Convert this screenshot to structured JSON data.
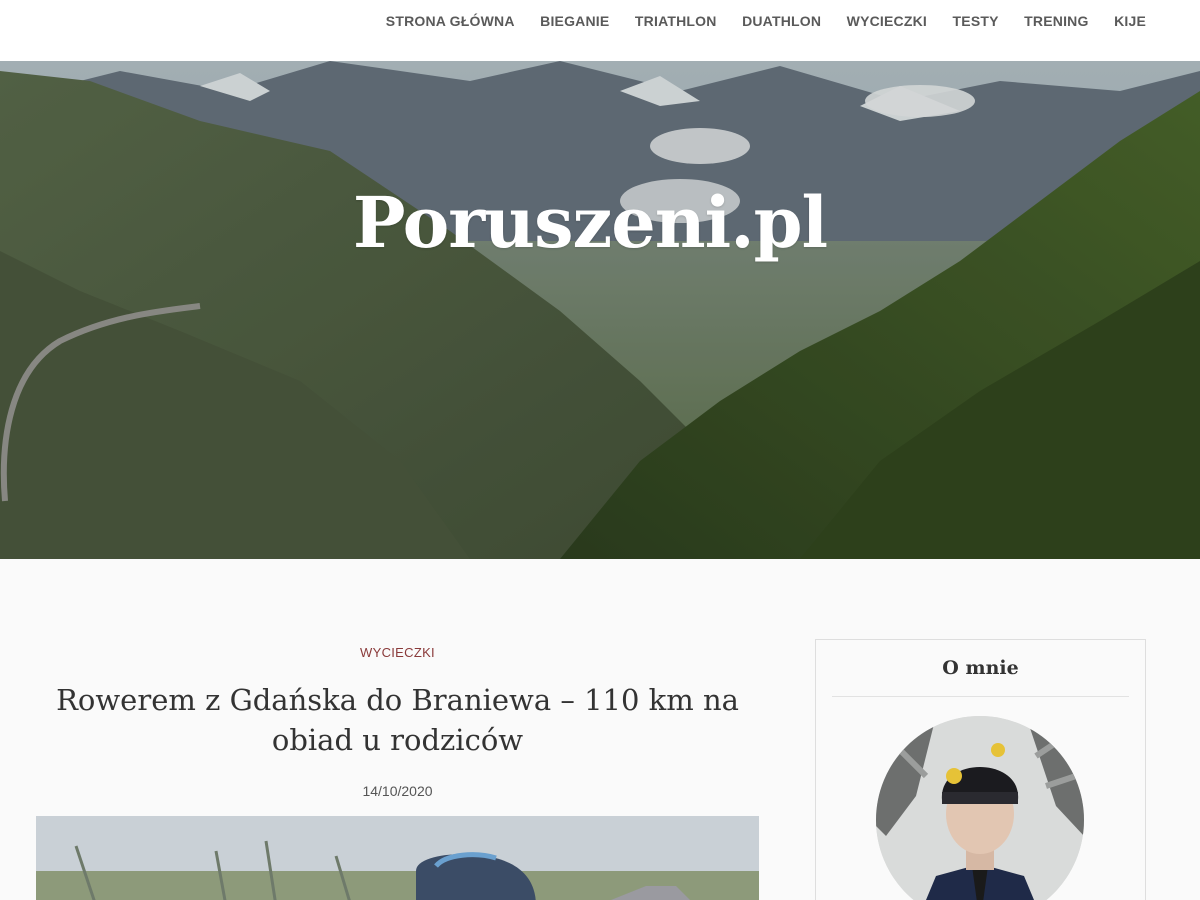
{
  "nav": {
    "items": [
      {
        "label": "STRONA GŁÓWNA"
      },
      {
        "label": "BIEGANIE"
      },
      {
        "label": "TRIATHLON"
      },
      {
        "label": "DUATHLON"
      },
      {
        "label": "WYCIECZKI"
      },
      {
        "label": "TESTY"
      },
      {
        "label": "TRENING"
      },
      {
        "label": "KIJE"
      }
    ]
  },
  "hero": {
    "site_title": "Poruszeni.pl"
  },
  "post": {
    "category": "WYCIECZKI",
    "title": "Rowerem z Gdańska do Braniewa – 110 km na obiad u rodziców",
    "date": "14/10/2020"
  },
  "sidebar": {
    "widget_title": "O mnie"
  },
  "colors": {
    "nav_text": "#5a5a5a",
    "category": "#8a3a3a",
    "background": "#fafafa"
  }
}
